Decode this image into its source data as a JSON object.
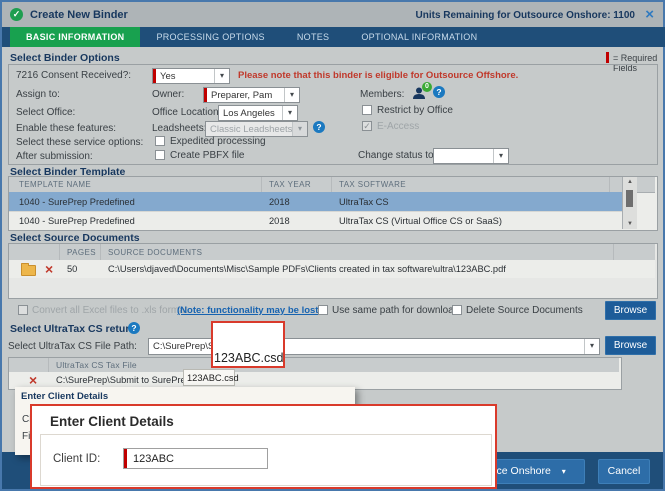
{
  "icons": {
    "check": "✓",
    "close": "×",
    "chevron": "▾",
    "help": "?",
    "delete": "×",
    "scroll_up": "▲",
    "scroll_down": "▼"
  },
  "window": {
    "title": "Create New Binder",
    "units_remaining": "Units Remaining for Outsource Onshore: 1100"
  },
  "tabs": [
    {
      "label": "BASIC INFORMATION"
    },
    {
      "label": "PROCESSING OPTIONS"
    },
    {
      "label": "NOTES"
    },
    {
      "label": "OPTIONAL INFORMATION"
    }
  ],
  "legend": {
    "required": "= Required Fields"
  },
  "binder_options": {
    "section_title": "Select Binder Options",
    "consent_label": "7216 Consent Received?:",
    "consent_value": "Yes",
    "consent_note": "Please note that this binder is eligible for Outsource Offshore.",
    "assign_label": "Assign to:",
    "owner_label": "Owner:",
    "owner_value": "Preparer, Pam",
    "members_label": "Members:",
    "members_badge": "0",
    "office_label": "Select Office:",
    "office_location_label": "Office Location:",
    "office_value": "Los Angeles",
    "restrict_label": "Restrict by Office",
    "features_label": "Enable these features:",
    "leadsheets_label": "Leadsheets:",
    "leadsheets_value": "Classic Leadsheets",
    "eaccess_label": "E-Access",
    "service_label": "Select these service options:",
    "expedited_label": "Expedited processing",
    "submission_label": "After submission:",
    "pbfx_label": "Create PBFX file",
    "change_status_label": "Change status to:"
  },
  "template_section": {
    "title": "Select Binder Template",
    "headers": [
      "TEMPLATE NAME",
      "TAX YEAR",
      "TAX SOFTWARE"
    ],
    "rows": [
      {
        "name": "1040 - SurePrep Predefined",
        "year": "2018",
        "software": "UltraTax CS"
      },
      {
        "name": "1040 - SurePrep Predefined",
        "year": "2018",
        "software": "UltraTax CS (Virtual Office CS or SaaS)"
      }
    ]
  },
  "source_section": {
    "title": "Select Source Documents",
    "col_pages": "PAGES",
    "col_docs": "SOURCE DOCUMENTS",
    "rows": [
      {
        "pages": "50",
        "path": "C:\\Users\\djaved\\Documents\\Misc\\Sample PDFs\\Clients created in tax software\\ultra\\123ABC.pdf"
      }
    ]
  },
  "options_row": {
    "convert_label": "Convert all Excel files to .xls format",
    "note_link": "(Note: functionality may be lost)",
    "same_path_label": "Use same path for download",
    "delete_label": "Delete Source Documents",
    "browse_label": "Browse"
  },
  "ultratax_section": {
    "title": "Select UltraTax CS return",
    "file_path_label": "Select UltraTax CS  File Path:",
    "file_path_value": "C:\\SurePrep\\Submit to SurePrep\\123ABC.csd",
    "browse_label": "Browse",
    "table_header": "UltraTax CS Tax File",
    "row_value": "C:\\SurePrep\\Submit to SurePrep\\123ABC.csd"
  },
  "tooltip": {
    "text": "123ABC.csd"
  },
  "callout": {
    "text": "123ABC.csd"
  },
  "client_panel": {
    "title": "Enter Client Details",
    "client_id_label": "Client ID:",
    "first_name_label": "First Name:"
  },
  "client_dialog": {
    "title": "Enter Client Details",
    "client_id_label": "Client ID:",
    "client_id_value": "123ABC"
  },
  "footer": {
    "outsource_label": "Outsource Onshore",
    "cancel_label": "Cancel"
  },
  "colors": {
    "accent_green": "#18A14F",
    "navy": "#1F4E79",
    "required_red": "#C00000",
    "notice_red": "#C0392B",
    "link_blue": "#1763B0",
    "selected_row": "#84A9CE",
    "annotation_red": "#D93A2B"
  }
}
